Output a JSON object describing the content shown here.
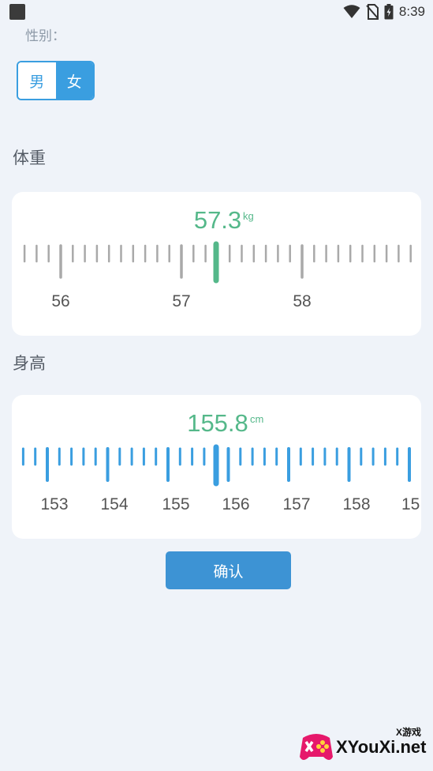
{
  "status_bar": {
    "time": "8:39",
    "icons": [
      "app-icon",
      "wifi-icon",
      "no-sim-icon",
      "battery-icon"
    ]
  },
  "gender": {
    "label": "性别：",
    "options": [
      "男",
      "女"
    ],
    "selected": "女"
  },
  "weight": {
    "title": "体重",
    "value": "57.3",
    "unit": "kg",
    "ruler": {
      "min_shown": 55.9,
      "max_shown": 57.3,
      "scale_labels": [
        "56",
        "57",
        "58"
      ],
      "selected_value": 57.3,
      "colors": {
        "ticks": "#a9a9a9",
        "indicator": "#55b88a",
        "value": "#55b88a"
      }
    }
  },
  "height": {
    "title": "身高",
    "value": "155.8",
    "unit": "cm",
    "ruler": {
      "scale_labels": [
        "153",
        "154",
        "155",
        "156",
        "157",
        "158",
        "15"
      ],
      "selected_value": 155.8,
      "colors": {
        "ticks": "#3a9ee0",
        "indicator": "#3a9ee0",
        "value": "#55b88a"
      }
    }
  },
  "confirm_button": {
    "label": "确认"
  },
  "watermark": {
    "text": "XYouXi.net",
    "sub": "X游戏"
  }
}
